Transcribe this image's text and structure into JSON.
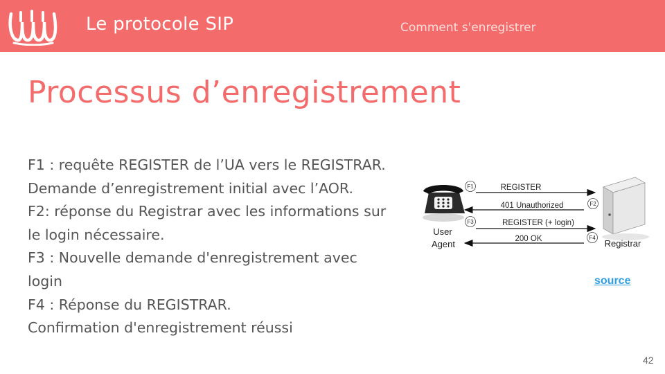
{
  "header": {
    "app_title": "Le protocole SIP",
    "section": "Comment s'enregistrer",
    "logo_icon": "wavy-logo-icon",
    "bar_color": "#f46b6b"
  },
  "slide": {
    "title": "Processus d’enregistrement",
    "title_color": "#f46b6b",
    "lines": [
      "F1 : requête REGISTER de l’UA vers le REGISTRAR.",
      "Demande d’enregistrement initial avec l’AOR.",
      "F2: réponse du Registrar avec les informations sur",
      "le login nécessaire.",
      "F3 : Nouvelle demande d'enregistrement avec",
      "login",
      "F4 : Réponse du REGISTRAR.",
      "Confirmation d'enregistrement réussi"
    ]
  },
  "diagram": {
    "user_agent_label": [
      "User",
      "Agent"
    ],
    "registrar_label": "Registrar",
    "user_agent_icon": "telephone-icon",
    "registrar_icon": "server-icon",
    "messages": [
      {
        "step": "F1",
        "label": "REGISTER",
        "direction": "to-registrar"
      },
      {
        "step": "F2",
        "label": "401 Unauthorized",
        "direction": "to-user-agent"
      },
      {
        "step": "F3",
        "label": "REGISTER (+ login)",
        "direction": "to-registrar"
      },
      {
        "step": "F4",
        "label": "200 OK",
        "direction": "to-user-agent"
      }
    ]
  },
  "source_link": "source",
  "page_number": "42"
}
